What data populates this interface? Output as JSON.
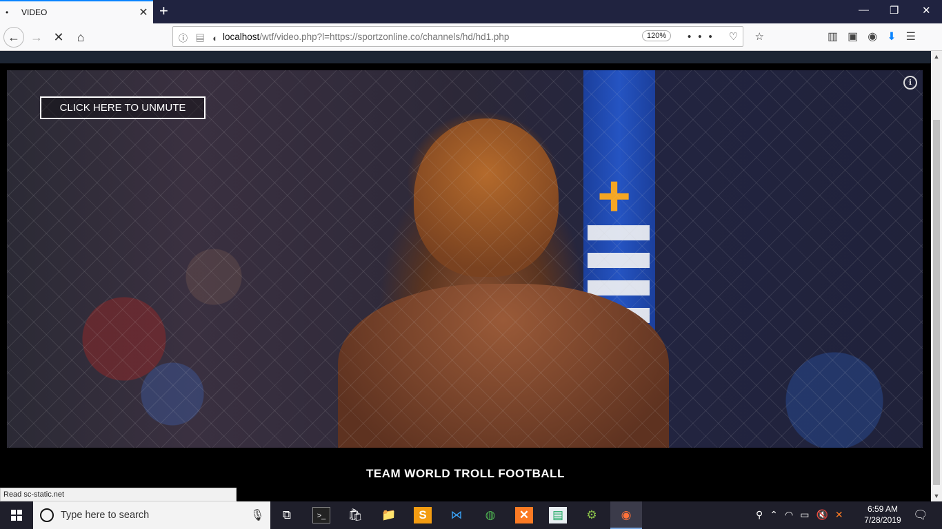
{
  "browser": {
    "tab_title": "VIDEO",
    "tab_dot": "•",
    "close_glyph": "✕",
    "new_tab_glyph": "+",
    "window_controls": {
      "minimize": "—",
      "restore": "❐",
      "close": "✕"
    },
    "nav": {
      "back": "←",
      "forward": "→",
      "stop": "✕",
      "home": "⌂"
    },
    "url_host": "localhost",
    "url_path": "/wtf/video.php?l=https://sportzonline.co/channels/hd/hd1.php",
    "zoom": "120%",
    "url_action_icons": "••• ♡ ☆",
    "toolbar_icons": [
      "library-icon",
      "sidebar-icon",
      "account-icon",
      "download-icon",
      "menu-icon"
    ],
    "accent_color": "#0a84ff"
  },
  "page": {
    "unmute_label": "CLICK HERE TO UNMUTE",
    "team_title": "TEAM WORLD TROLL FOOTBALL",
    "status_text": "Read sc-static.net"
  },
  "taskbar": {
    "search_placeholder": "Type here to search",
    "apps": [
      "task-view",
      "terminal",
      "store",
      "file-explorer",
      "sublime-text",
      "vscode",
      "chrome",
      "xampp",
      "remote-app",
      "android-studio",
      "firefox"
    ],
    "time": "6:59 AM",
    "date": "7/28/2019"
  }
}
